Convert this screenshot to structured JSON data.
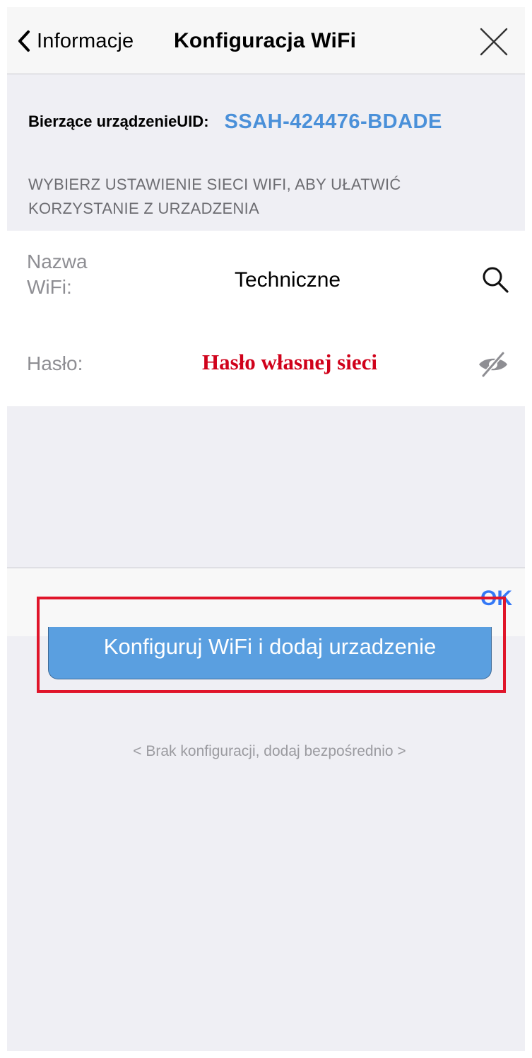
{
  "navbar": {
    "back_label": "Informacje",
    "title": "Konfiguracja WiFi"
  },
  "device": {
    "uid_label": "Bierzące urządzenieUID:",
    "uid_value": "SSAH-424476-BDADE"
  },
  "hint": "WYBIERZ USTAWIENIE SIECI WIFI, ABY UŁATWIĆ KORZYSTANIE Z URZADZENIA",
  "form": {
    "wifi_label": "Nazwa WiFi:",
    "wifi_value": "Techniczne",
    "password_label": "Hasło:",
    "password_value": "Hasło własnej sieci"
  },
  "toolbar": {
    "ok_label": "OK"
  },
  "primary_button": "Konfiguruj WiFi i dodaj urzadzenie",
  "skip_link": "< Brak konfiguracji, dodaj bezpośrednio >",
  "icons": {
    "back": "chevron-left-icon",
    "close": "close-icon",
    "search": "search-icon",
    "visibility": "eye-slash-icon"
  },
  "colors": {
    "uid": "#4a90d9",
    "password_text": "#d0021b",
    "ok": "#3478f6",
    "primary_button": "#5a9fe0",
    "highlight": "#e0152a"
  }
}
